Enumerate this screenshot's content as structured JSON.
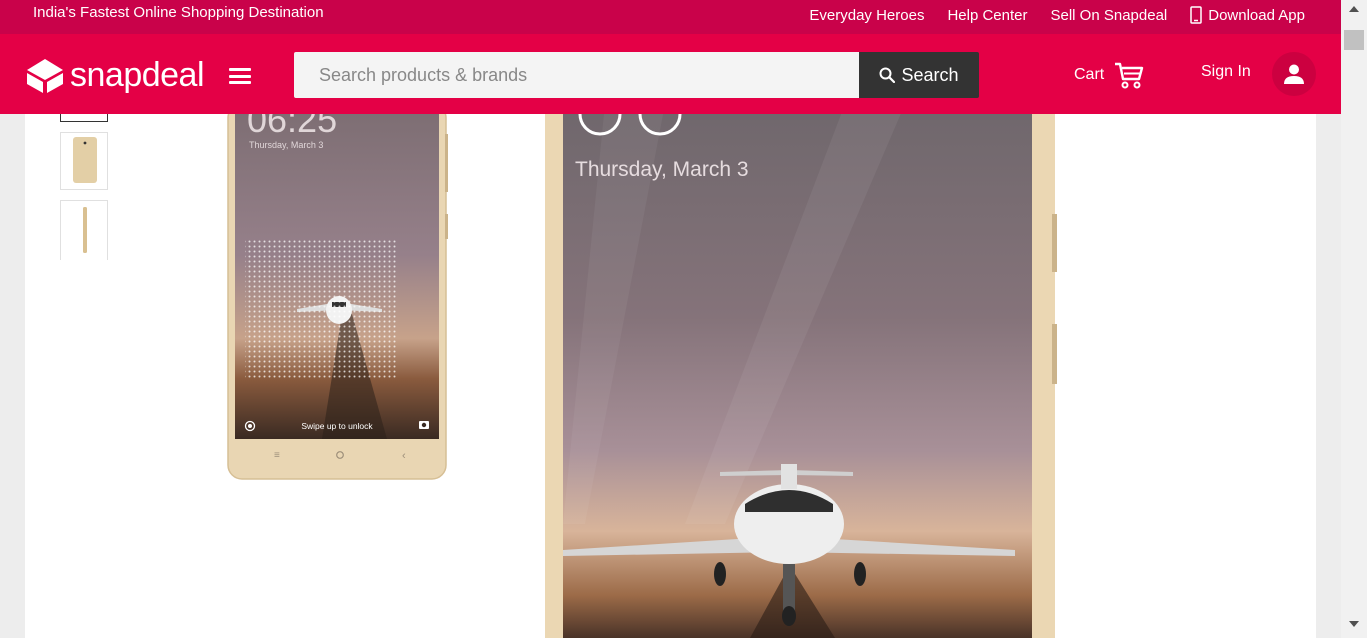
{
  "topbar": {
    "tagline": "India's Fastest Online Shopping Destination",
    "links": [
      "Everyday Heroes",
      "Help Center",
      "Sell On Snapdeal"
    ],
    "download_app": "Download App"
  },
  "header": {
    "logo_text": "snapdeal",
    "search_placeholder": "Search products & brands",
    "search_button": "Search",
    "cart_label": "Cart",
    "signin_label": "Sign In"
  },
  "product": {
    "phone_small": {
      "time": "06:25",
      "date": "Thursday, March 3",
      "unlock_hint": "Swipe up to unlock"
    },
    "phone_large": {
      "date": "Thursday, March 3"
    }
  },
  "colors": {
    "topbar": "#c9024a",
    "header": "#e40046",
    "search_button": "#333333",
    "phone_gold": "#e8d2ae"
  }
}
